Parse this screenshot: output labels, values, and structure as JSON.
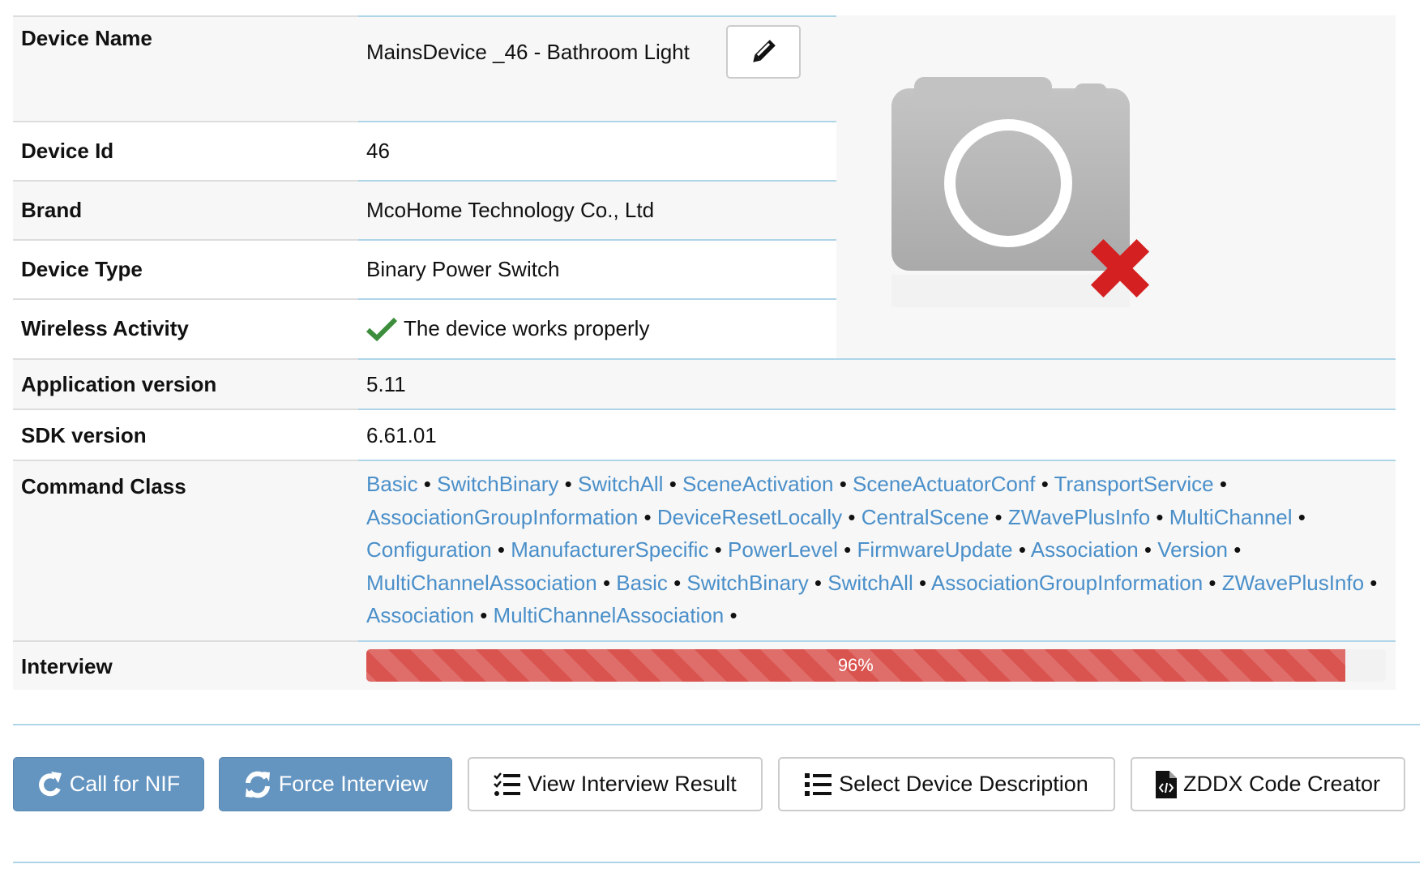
{
  "device": {
    "name_label": "Device Name",
    "name_value": "MainsDevice _46 - Bathroom Light",
    "id_label": "Device Id",
    "id_value": "46",
    "brand_label": "Brand",
    "brand_value": "McoHome Technology Co., Ltd",
    "type_label": "Device Type",
    "type_value": "Binary Power Switch",
    "wireless_label": "Wireless Activity",
    "wireless_value": "The device works properly",
    "app_label": "Application version",
    "app_value": "5.11",
    "sdk_label": "SDK version",
    "sdk_value": "6.61.01",
    "cc_label": "Command Class",
    "command_classes": [
      "Basic",
      "SwitchBinary",
      "SwitchAll",
      "SceneActivation",
      "SceneActuatorConf",
      "TransportService",
      "AssociationGroupInformation",
      "DeviceResetLocally",
      "CentralScene",
      "ZWavePlusInfo",
      "MultiChannel",
      "Configuration",
      "ManufacturerSpecific",
      "PowerLevel",
      "FirmwareUpdate",
      "Association",
      "Version",
      "MultiChannelAssociation",
      "Basic",
      "SwitchBinary",
      "SwitchAll",
      "AssociationGroupInformation",
      "ZWavePlusInfo",
      "Association",
      "MultiChannelAssociation"
    ],
    "interview_label": "Interview",
    "interview_progress": 96,
    "interview_text": "96%"
  },
  "colors": {
    "link": "#4a8fc9",
    "primary": "#6495c0",
    "danger": "#d9534f",
    "success": "#3c8d3c"
  },
  "buttons": {
    "call_nif": "Call for NIF",
    "force_interview": "Force Interview",
    "view_result": "View Interview Result",
    "select_description": "Select Device Description",
    "zddx": "ZDDX Code Creator"
  }
}
